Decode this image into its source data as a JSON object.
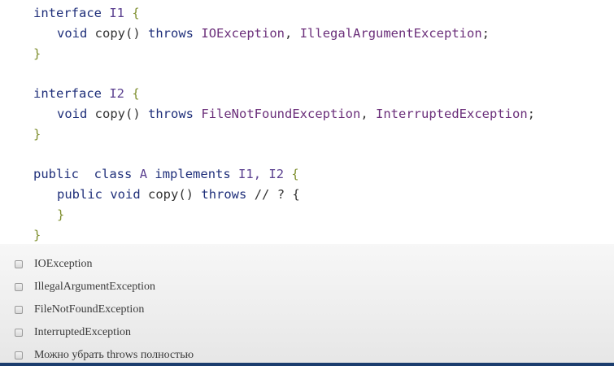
{
  "code": {
    "i1_kw": "interface",
    "i1_name": "I1",
    "open_brace": "{",
    "close_brace": "}",
    "void_kw": "void",
    "copy_sig": "copy()",
    "throws_kw": "throws",
    "i1_ex1": "IOException",
    "i1_ex2": "IllegalArgumentException",
    "comma": ",",
    "semicolon": ";",
    "i2_kw": "interface",
    "i2_name": "I2",
    "i2_ex1": "FileNotFoundException",
    "i2_ex2": "InterruptedException",
    "public_kw": "public",
    "class_kw": "class",
    "class_name": "A",
    "implements_kw": "implements",
    "implements_list": "I1, I2",
    "comment": "// ? {"
  },
  "options": [
    {
      "label": "IOException"
    },
    {
      "label": "IllegalArgumentException"
    },
    {
      "label": "FileNotFoundException"
    },
    {
      "label": "InterruptedException"
    },
    {
      "label": "Можно убрать throws полностью"
    }
  ],
  "colors": {
    "keyword": "#1f2f7a",
    "brace": "#7f8f2f",
    "exception": "#6b2f7a",
    "bottom_bar": "#1b3d6e"
  }
}
